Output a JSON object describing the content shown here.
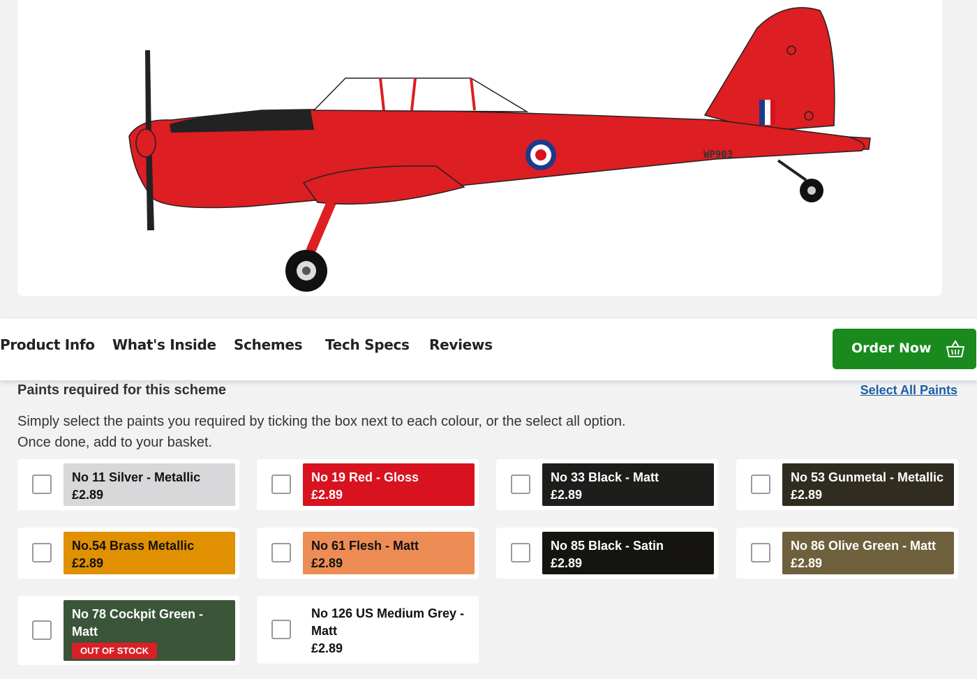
{
  "hero": {
    "aircraft_image": "red-chipmunk-aircraft-side-view",
    "serial": "WP903"
  },
  "tabs": [
    "Product Info",
    "What's Inside",
    "Schemes",
    "Tech Specs",
    "Reviews"
  ],
  "order": {
    "label": "Order Now",
    "icon": "basket-icon",
    "color": "#1a8a1f"
  },
  "paints": {
    "title": "Paints required for this scheme",
    "select_all": "Select All Paints",
    "instructions_line1": "Simply select the paints you required by ticking the box next to each colour, or the select all option.",
    "instructions_line2": "Once done, add to your basket.",
    "items": [
      {
        "name": "No 11 Silver - Metallic",
        "price": "£2.89",
        "color": "#d8d8da",
        "text_color": "#111111"
      },
      {
        "name": "No 19 Red - Gloss",
        "price": "£2.89",
        "color": "#d8121f",
        "text_color": "#ffffff"
      },
      {
        "name": "No 33 Black - Matt",
        "price": "£2.89",
        "color": "#1d1d1b",
        "text_color": "#ffffff"
      },
      {
        "name": "No 53 Gunmetal - Metallic",
        "price": "£2.89",
        "color": "#302d20",
        "text_color": "#ffffff"
      },
      {
        "name": "No.54 Brass Metallic",
        "price": "£2.89",
        "color": "#e09000",
        "text_color": "#111111"
      },
      {
        "name": "No 61 Flesh - Matt",
        "price": "£2.89",
        "color": "#ed8d55",
        "text_color": "#111111"
      },
      {
        "name": "No 85 Black - Satin",
        "price": "£2.89",
        "color": "#151411",
        "text_color": "#ffffff"
      },
      {
        "name": "No 86 Olive Green - Matt",
        "price": "£2.89",
        "color": "#6e603c",
        "text_color": "#ffffff"
      },
      {
        "name": "No 78 Cockpit Green - Matt",
        "price": "",
        "badge": "OUT OF STOCK",
        "color": "#3a5538",
        "text_color": "#ffffff"
      },
      {
        "name": "No 126 US Medium Grey - Matt",
        "price": "£2.89",
        "color": "#ffffff",
        "text_color": "#111111"
      }
    ]
  }
}
